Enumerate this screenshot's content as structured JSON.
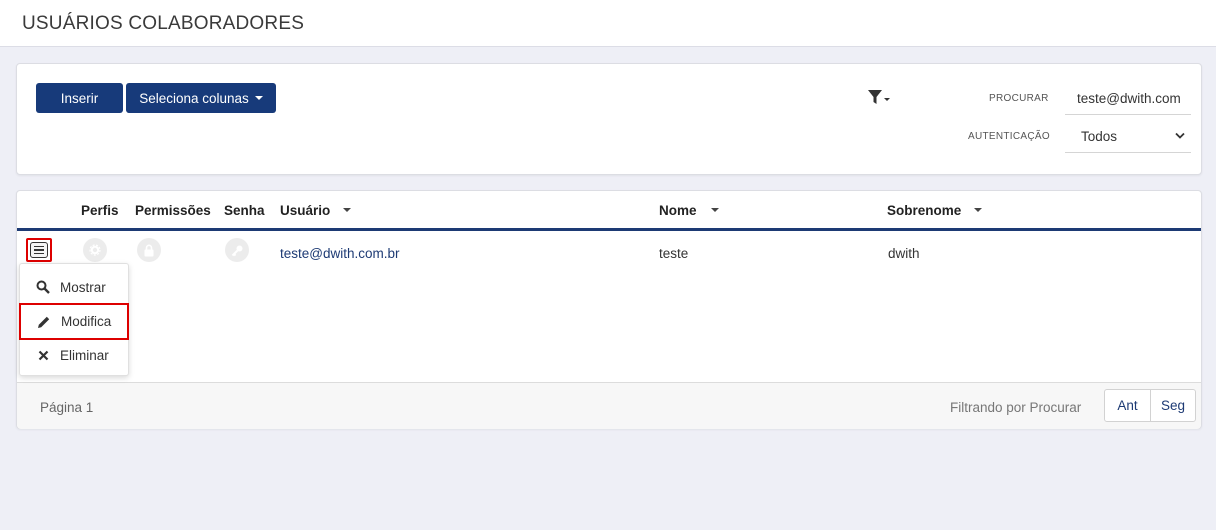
{
  "header": {
    "title": "USUÁRIOS COLABORADORES"
  },
  "toolbar": {
    "insert_label": "Inserir",
    "columns_label": "Seleciona colunas",
    "search_label": "PROCURAR",
    "search_value": "teste@dwith.com",
    "auth_label": "AUTENTICAÇÃO",
    "auth_value": "Todos"
  },
  "table": {
    "columns": [
      "Perfis",
      "Permissões",
      "Senha",
      "Usuário",
      "Nome",
      "Sobrenome"
    ],
    "rows": [
      {
        "usuario": "teste@dwith.com.br",
        "nome": "teste",
        "sobrenome": "dwith"
      }
    ]
  },
  "row_menu": {
    "items": [
      "Mostrar",
      "Modifica",
      "Eliminar"
    ]
  },
  "footer": {
    "page_text": "Página 1",
    "filter_text": "Filtrando por Procurar",
    "prev_label": "Ant",
    "next_label": "Seg"
  },
  "colors": {
    "primary": "#173a7a",
    "highlight": "#dd0000"
  }
}
